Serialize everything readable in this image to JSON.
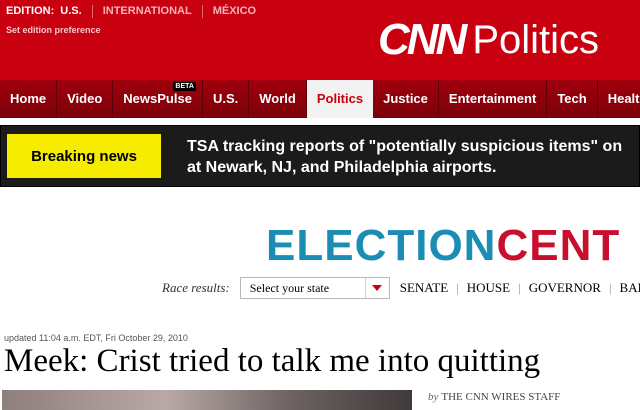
{
  "header": {
    "edition_label": "EDITION:",
    "editions": [
      "U.S.",
      "INTERNATIONAL",
      "MÉXICO"
    ],
    "set_preference": "Set edition preference",
    "logo_brand": "CNN",
    "logo_section": "Politics",
    "colors": {
      "brand_red": "#c8000f"
    }
  },
  "nav": {
    "items": [
      {
        "label": "Home"
      },
      {
        "label": "Video"
      },
      {
        "label": "NewsPulse",
        "badge": "BETA"
      },
      {
        "label": "U.S."
      },
      {
        "label": "World"
      },
      {
        "label": "Politics",
        "active": true
      },
      {
        "label": "Justice"
      },
      {
        "label": "Entertainment"
      },
      {
        "label": "Tech"
      },
      {
        "label": "Health"
      }
    ]
  },
  "breaking": {
    "label": "Breaking news",
    "line1": "TSA tracking reports of \"potentially suspicious items\" on",
    "line2": "at Newark, NJ, and Philadelphia airports.",
    "colors": {
      "label_bg": "#f6ec00",
      "bar_bg": "#1b1b1b"
    }
  },
  "election": {
    "word_blue": "ELECTION",
    "word_red": "CENT",
    "colors": {
      "blue": "#1b8db5",
      "red": "#c8102e"
    }
  },
  "race": {
    "label": "Race results:",
    "select_value": "Select your state",
    "links": [
      "SENATE",
      "HOUSE",
      "GOVERNOR",
      "BALL"
    ]
  },
  "article": {
    "updated": "updated 11:04 a.m. EDT, Fri October 29, 2010",
    "headline": "Meek: Crist tried to talk me into quitting",
    "byline_prefix": "by",
    "byline": "THE CNN WIRES STAFF"
  }
}
